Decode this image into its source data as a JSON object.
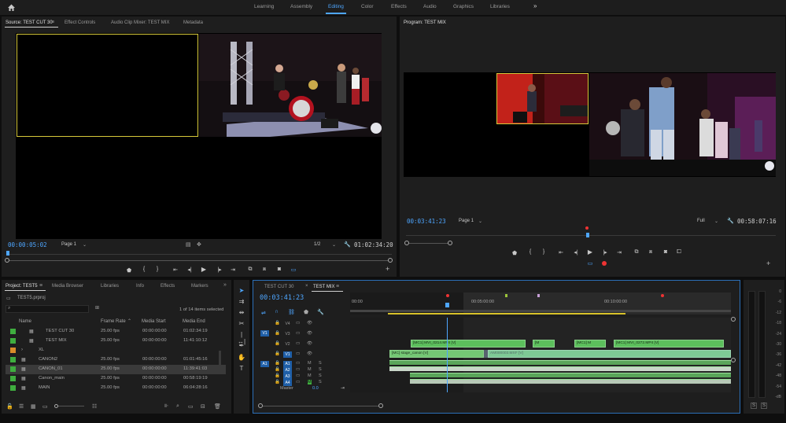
{
  "workspaces": {
    "items": [
      "Learning",
      "Assembly",
      "Editing",
      "Color",
      "Effects",
      "Audio",
      "Graphics",
      "Libraries"
    ],
    "active": "Editing",
    "more_label": "»"
  },
  "source_monitor": {
    "tabs": [
      "Source: TEST CUT 30",
      "Effect Controls",
      "Audio Clip Mixer: TEST MIX",
      "Metadata"
    ],
    "timecode_left": "00:00:05:02",
    "page_label": "Page 1",
    "resolution": "1/2",
    "timecode_right": "01:02:34:20"
  },
  "program_monitor": {
    "tab": "Program: TEST MIX",
    "timecode_left": "00:03:41:23",
    "page_label": "Page 1",
    "resolution": "Full",
    "timecode_right": "00:58:07:16"
  },
  "project_panel": {
    "tabs": [
      "Project: TEST5",
      "Media Browser",
      "Libraries",
      "Info",
      "Effects",
      "Markers"
    ],
    "file_name": "TEST5.prproj",
    "selection_info": "1 of 14 items selected",
    "columns": [
      "Name",
      "Frame Rate",
      "Media Start",
      "Media End"
    ],
    "rows": [
      {
        "name": "TEST CUT 30",
        "rate": "25.00 fps",
        "start": "00:00:00:00",
        "end": "01:02:34:19",
        "color": "#3fae3f",
        "indent": true
      },
      {
        "name": "TEST MIX",
        "rate": "25.00 fps",
        "start": "00:00:00:00",
        "end": "11:41:10:12",
        "color": "#3fae3f",
        "indent": true
      },
      {
        "name": "XL",
        "rate": "",
        "start": "",
        "end": "",
        "color": "#d98c2a",
        "indent": false
      },
      {
        "name": "CANON2",
        "rate": "25.00 fps",
        "start": "00:00:00:00",
        "end": "01:01:45:16",
        "color": "#3fae3f",
        "indent": false
      },
      {
        "name": "CANON_01",
        "rate": "25.00 fps",
        "start": "00:00:00:00",
        "end": "11:39:41:03",
        "color": "#3fae3f",
        "indent": false
      },
      {
        "name": "Canon_main",
        "rate": "25.00 fps",
        "start": "00:00:00:00",
        "end": "00:58:19:19",
        "color": "#3fae3f",
        "indent": false
      },
      {
        "name": "MAIN",
        "rate": "25.00 fps",
        "start": "00:00:00:00",
        "end": "06:04:28:16",
        "color": "#3fae3f",
        "indent": false
      }
    ]
  },
  "timeline": {
    "tabs": [
      "TEST CUT 30",
      "TEST MIX"
    ],
    "timecode": "00:03:41:23",
    "ruler": [
      "00:00",
      "00:05:00:00",
      "00:10:00:00"
    ],
    "video_tracks": [
      "V4",
      "V3",
      "V2",
      "V1"
    ],
    "audio_tracks": [
      "A1",
      "A2",
      "A3",
      "A4"
    ],
    "src_v": "V1",
    "src_a": "A1",
    "master_label": "Master",
    "master_value": "0.0",
    "clips": {
      "v2_a": "[MC1] MVI_0214.MP4 [V]",
      "v2_b": "[M",
      "v2_c": "[MC1] M",
      "v2_d": "[MC1] MVI_0272.MP4 [V]",
      "v1_a": "[MC] stage_canon [V]",
      "v1_b": "AM000003.MXF [V]"
    },
    "mute_label": "M",
    "solo_label": "S"
  },
  "audio_meter": {
    "scale": [
      "0",
      "-6",
      "-12",
      "-18",
      "-24",
      "-30",
      "-36",
      "-42",
      "-48",
      "-54",
      "-dB"
    ],
    "solo_labels": [
      "S",
      "S"
    ]
  },
  "icons": [
    "home-icon",
    "play-icon",
    "step-back-icon",
    "step-forward-icon",
    "mark-in-icon",
    "mark-out-icon",
    "camera-icon",
    "wrench-icon",
    "selection-tool-icon",
    "razor-icon",
    "hand-icon",
    "type-icon",
    "pen-icon"
  ]
}
